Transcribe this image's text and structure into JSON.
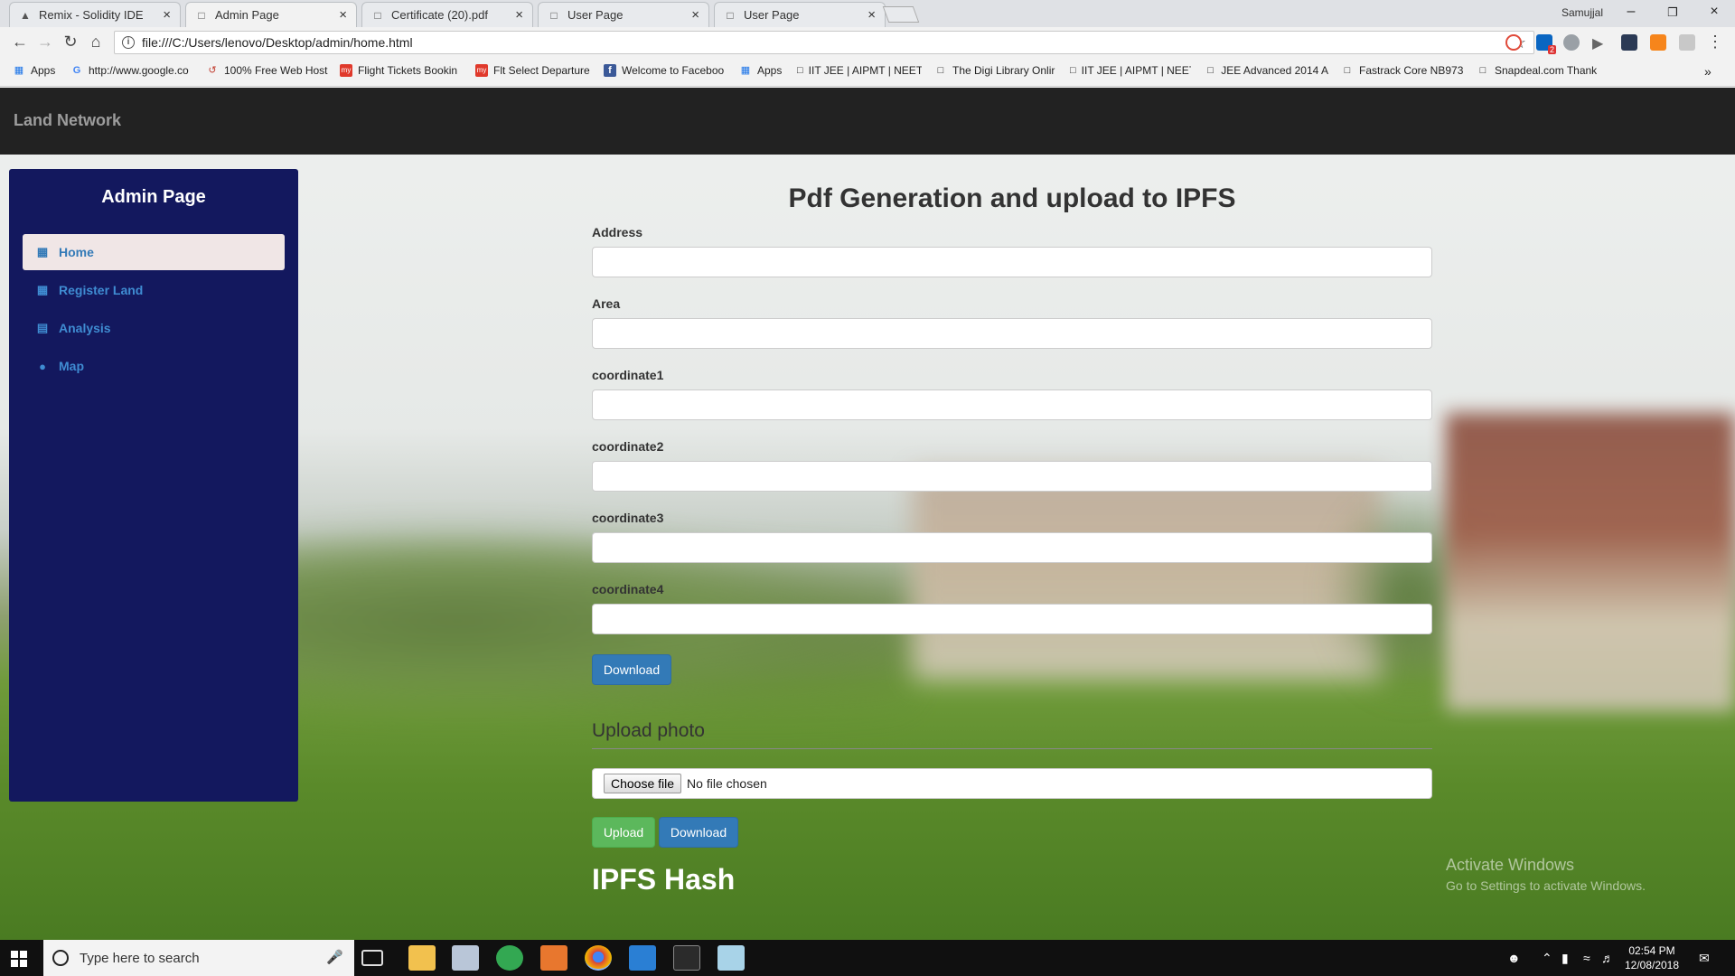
{
  "browser": {
    "tabs": [
      {
        "title": "Remix - Solidity IDE",
        "active": false
      },
      {
        "title": "Admin Page",
        "active": true
      },
      {
        "title": "Certificate (20).pdf",
        "active": false
      },
      {
        "title": "User Page",
        "active": false
      },
      {
        "title": "User Page",
        "active": false
      }
    ],
    "window_user": "Samujjal",
    "url": "file:///C:/Users/lenovo/Desktop/admin/home.html",
    "extension_badge": "2",
    "bookmarks": [
      {
        "label": "Apps",
        "icon": "apps-grid-icon"
      },
      {
        "label": "http://www.google.co",
        "icon": "google-icon"
      },
      {
        "label": "100% Free Web Host",
        "icon": "webhost-icon"
      },
      {
        "label": "Flight Tickets Bookin",
        "icon": "makemytrip-icon"
      },
      {
        "label": "Flt Select Departure",
        "icon": "makemytrip-icon"
      },
      {
        "label": "Welcome to Faceboo",
        "icon": "facebook-icon"
      },
      {
        "label": "Apps",
        "icon": "apps-grid-icon"
      },
      {
        "label": "IIT JEE | AIPMT | NEET",
        "icon": "page-icon"
      },
      {
        "label": "The Digi Library Onlir",
        "icon": "page-icon"
      },
      {
        "label": "IIT JEE | AIPMT | NEET",
        "icon": "page-icon"
      },
      {
        "label": "JEE Advanced 2014 A",
        "icon": "page-icon"
      },
      {
        "label": "Fastrack Core NB973",
        "icon": "page-icon"
      },
      {
        "label": "Snapdeal.com Thank",
        "icon": "page-icon"
      }
    ],
    "bookmarks_overflow": "»"
  },
  "app": {
    "brand": "Land Network",
    "sidebar": {
      "title": "Admin Page",
      "items": [
        {
          "label": "Home",
          "icon": "th-grid-icon",
          "active": true
        },
        {
          "label": "Register Land",
          "icon": "th-grid-icon",
          "active": false
        },
        {
          "label": "Analysis",
          "icon": "list-alt-icon",
          "active": false
        },
        {
          "label": "Map",
          "icon": "map-marker-icon",
          "active": false
        }
      ]
    },
    "form": {
      "heading": "Pdf Generation and upload to IPFS",
      "fields": [
        {
          "label": "Address",
          "value": ""
        },
        {
          "label": "Area",
          "value": ""
        },
        {
          "label": "coordinate1",
          "value": ""
        },
        {
          "label": "coordinate2",
          "value": ""
        },
        {
          "label": "coordinate3",
          "value": ""
        },
        {
          "label": "coordinate4",
          "value": ""
        }
      ],
      "download_label": "Download"
    },
    "upload": {
      "heading": "Upload photo",
      "choose_file_label": "Choose file",
      "no_file_text": "No file chosen",
      "upload_label": "Upload",
      "download_label": "Download"
    },
    "ipfs_heading": "IPFS Hash"
  },
  "watermark": {
    "line1": "Activate Windows",
    "line2": "Go to Settings to activate Windows."
  },
  "taskbar": {
    "search_placeholder": "Type here to search",
    "time": "02:54 PM",
    "date": "12/08/2018"
  },
  "colors": {
    "sidebar_bg": "#13185e",
    "navbar_bg": "#222222",
    "primary": "#337ab7",
    "success": "#5cb85c"
  }
}
